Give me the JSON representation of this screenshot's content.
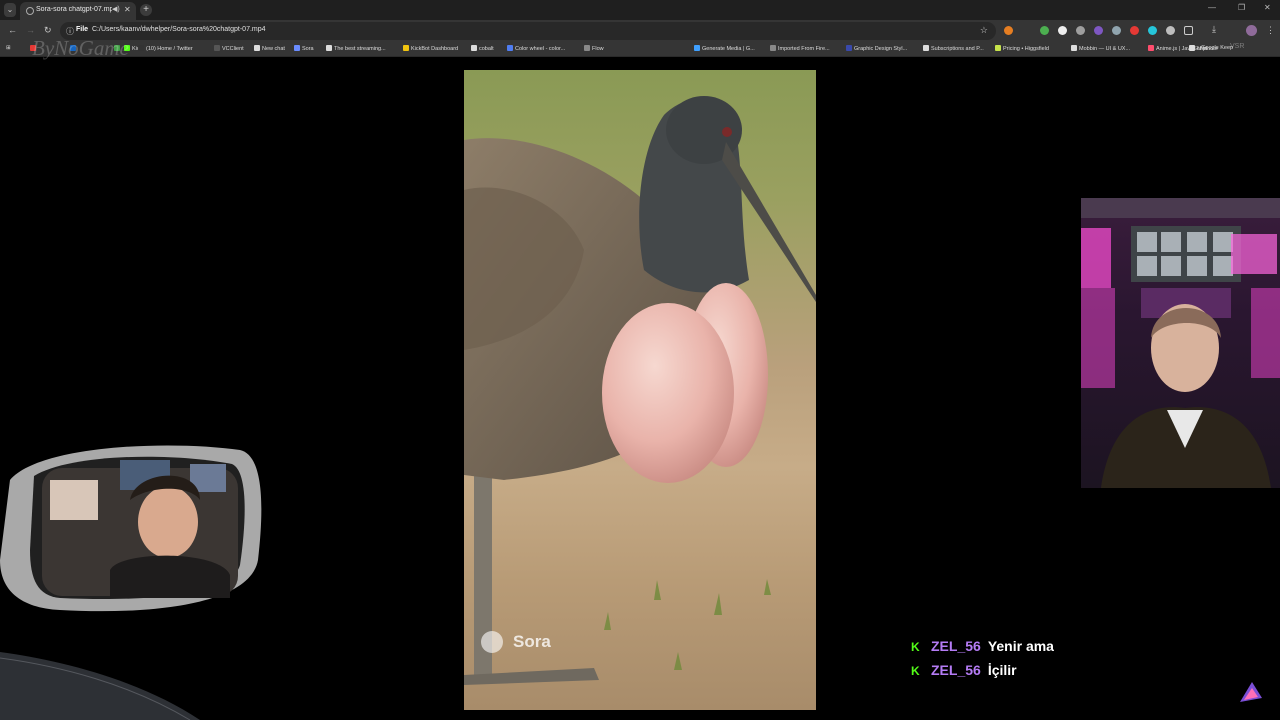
{
  "browser": {
    "tab_title": "Sora-sora chatgpt-07.mp4",
    "scheme_label": "File",
    "url": "C:/Users/kaanv/dwhelper/Sora-sora%20chatgpt-07.mp4"
  },
  "bookmarks": [
    {
      "label": "",
      "color": "#e53935"
    },
    {
      "label": "",
      "color": "#1565c0"
    },
    {
      "label": "",
      "color": "#43a047"
    },
    {
      "label": "Kick",
      "color": "#53fc18"
    },
    {
      "label": "(10) Home / Twitter",
      "color": "#333333"
    },
    {
      "label": "VCClient",
      "color": "#555555"
    },
    {
      "label": "New chat",
      "color": "#dddddd"
    },
    {
      "label": "Sora",
      "color": "#6a8cff"
    },
    {
      "label": "The best streaming...",
      "color": "#dddddd"
    },
    {
      "label": "KickBot Dashboard",
      "color": "#f1c40f"
    },
    {
      "label": "cobalt",
      "color": "#dddddd"
    },
    {
      "label": "Color wheel - color...",
      "color": "#4f7df2"
    },
    {
      "label": "Flow",
      "color": "#888888"
    },
    {
      "label": "Generate Media | G...",
      "color": "#3fa0ff"
    },
    {
      "label": "Imported From Fire...",
      "color": "#888888"
    },
    {
      "label": "Graphic Design Styl...",
      "color": "#3949ab"
    },
    {
      "label": "Subscriptions and P...",
      "color": "#dddddd"
    },
    {
      "label": "Pricing • Higgsfield",
      "color": "#c6e34a"
    },
    {
      "label": "Mobbin — UI & UX...",
      "color": "#dddddd"
    },
    {
      "label": "Anime.js | JavaScript...",
      "color": "#ff4d6d"
    },
    {
      "label": "Milanote",
      "color": "#dddddd"
    },
    {
      "label": "Google Keep",
      "color": "#f6bf26"
    }
  ],
  "overlay": {
    "watermark": "ByNoGame",
    "corner_mark": "VSR"
  },
  "video": {
    "brand_label": "Sora"
  },
  "chat": [
    {
      "user": "ZEL_56",
      "message": "Yenir ama"
    },
    {
      "user": "ZEL_56",
      "message": "İçilir"
    }
  ],
  "colors": {
    "kick_green": "#53fc18",
    "chat_username": "#b57cf5"
  }
}
